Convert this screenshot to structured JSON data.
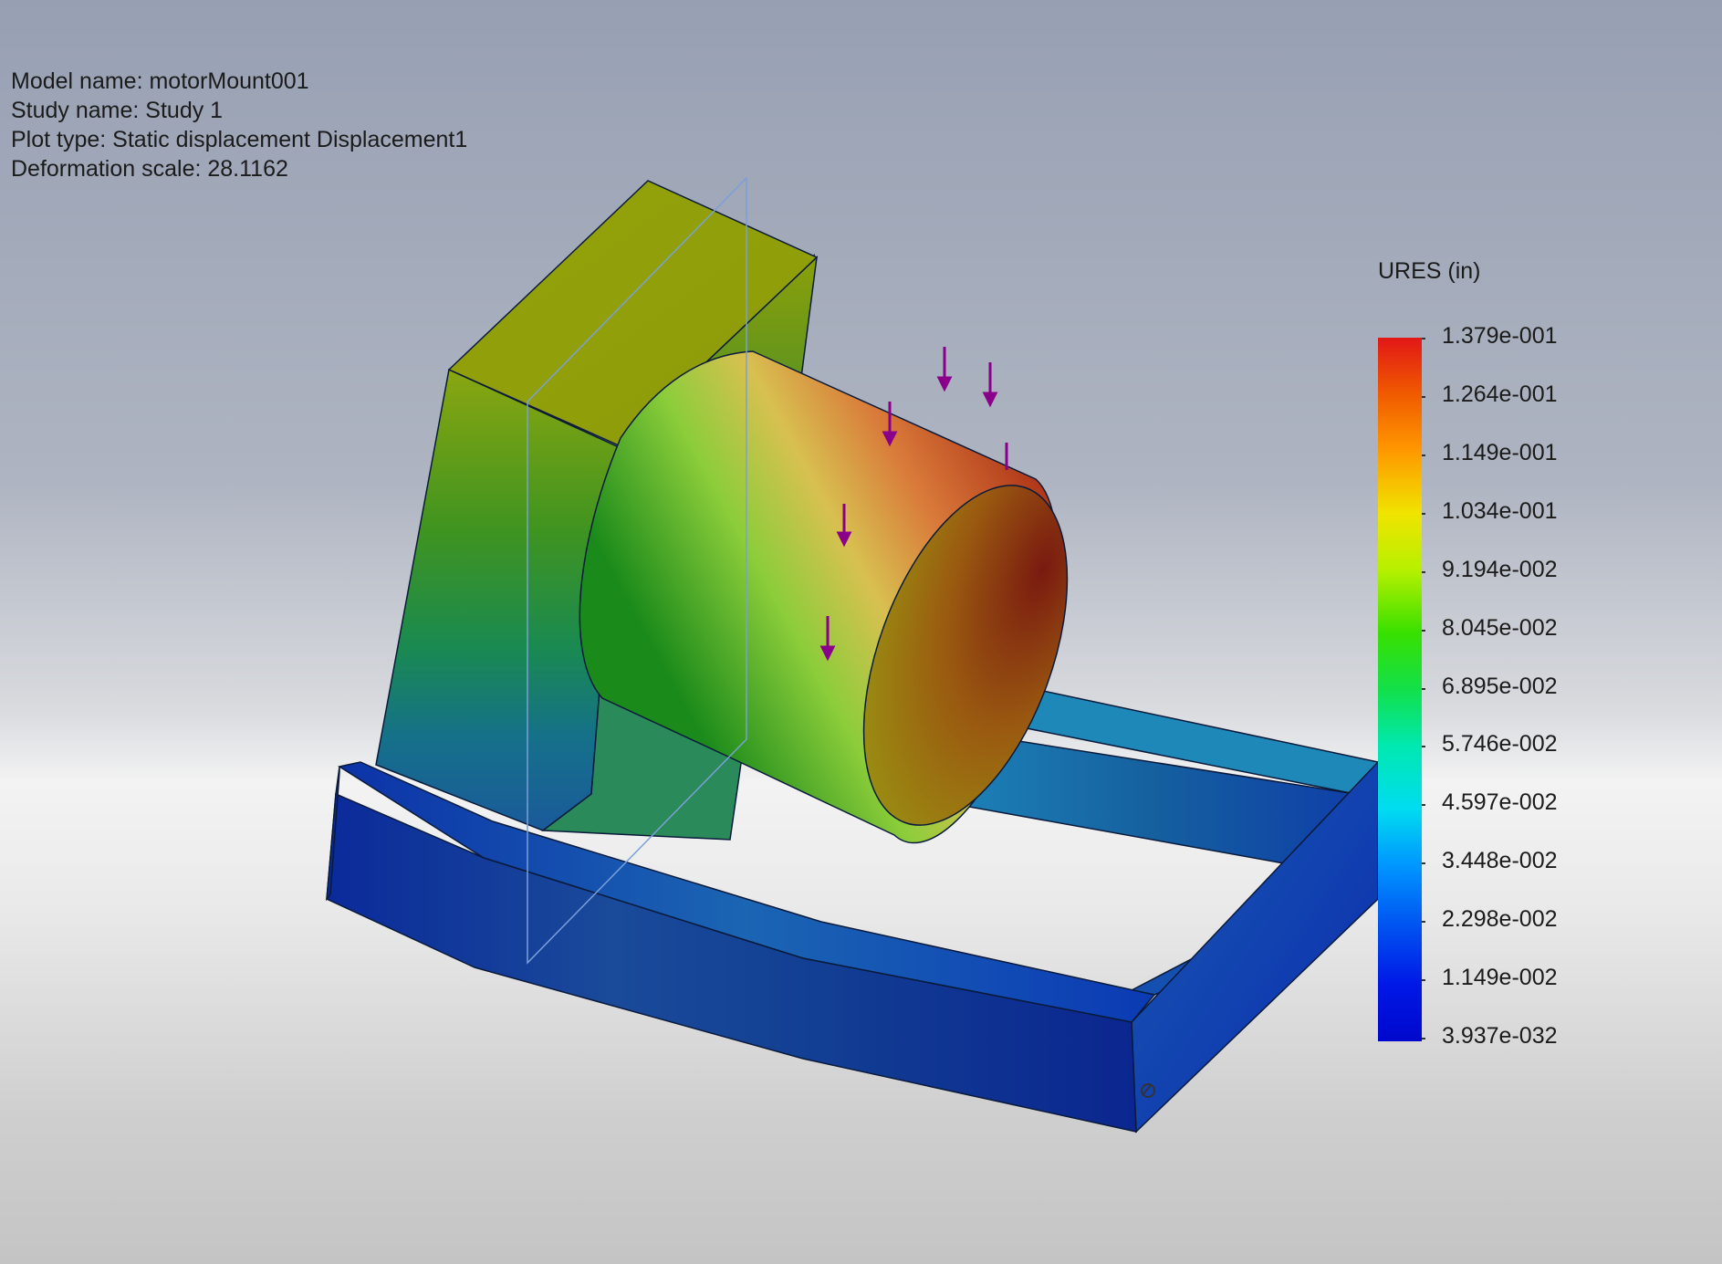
{
  "info": {
    "model_name": "Model name: motorMount001",
    "study_name": "Study name: Study 1",
    "plot_type": "Plot type: Static displacement Displacement1",
    "deformation_scale": "Deformation scale: 28.1162"
  },
  "legend": {
    "title": "URES (in)",
    "labels": [
      "1.379e-001",
      "1.264e-001",
      "1.149e-001",
      "1.034e-001",
      "9.194e-002",
      "8.045e-002",
      "6.895e-002",
      "5.746e-002",
      "4.597e-002",
      "3.448e-002",
      "2.298e-002",
      "1.149e-002",
      "3.937e-032"
    ]
  },
  "colors": {
    "load_arrow": "#8b008b",
    "max": "#e21717",
    "min": "#0008cc"
  },
  "icons": {
    "load_arrows": "external-force-arrow-icon",
    "fixture": "fixture-icon"
  }
}
